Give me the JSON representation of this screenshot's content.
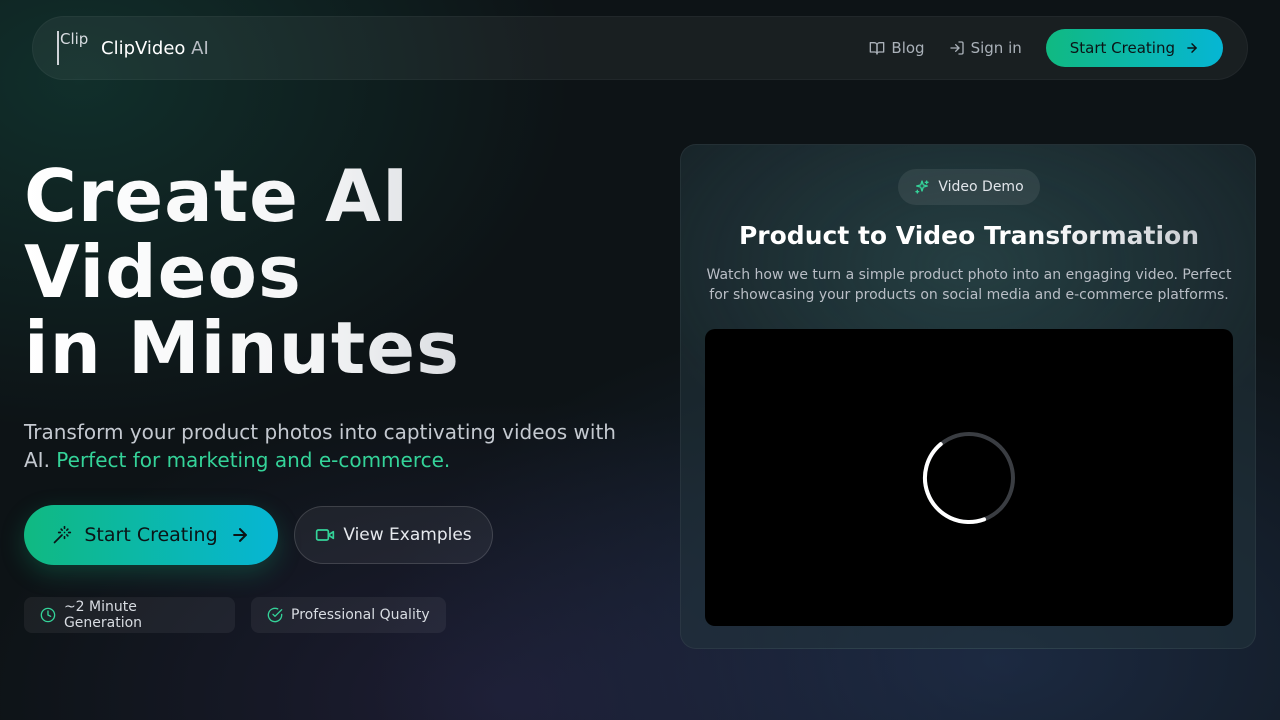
{
  "nav": {
    "logo_alt": "Clip",
    "brand_name": "ClipVideo",
    "brand_suffix": "AI",
    "links": [
      {
        "label": "Blog",
        "icon": "book-icon"
      },
      {
        "label": "Sign in",
        "icon": "sign-in-icon"
      }
    ],
    "cta_label": "Start Creating"
  },
  "hero": {
    "title_lines": [
      "Create AI",
      "Videos",
      "in Minutes"
    ],
    "subtitle": "Transform your product photos into captivating videos with AI.",
    "subtitle_accent": "Perfect for marketing and e-commerce.",
    "primary_button": "Start Creating",
    "secondary_button": "View Examples",
    "badges": [
      {
        "label": "~2 Minute Generation",
        "icon": "clock-icon"
      },
      {
        "label": "Professional Quality",
        "icon": "check-circle-icon"
      }
    ]
  },
  "demo": {
    "pill_label": "Video Demo",
    "title": "Product to Video Transformation",
    "description": "Watch how we turn a simple product photo into an engaging video. Perfect for showcasing your products on social media and e-commerce platforms.",
    "video_state": "loading"
  },
  "colors": {
    "accent_start": "#10b981",
    "accent_end": "#06b6d4",
    "accent_text": "#34d399"
  }
}
